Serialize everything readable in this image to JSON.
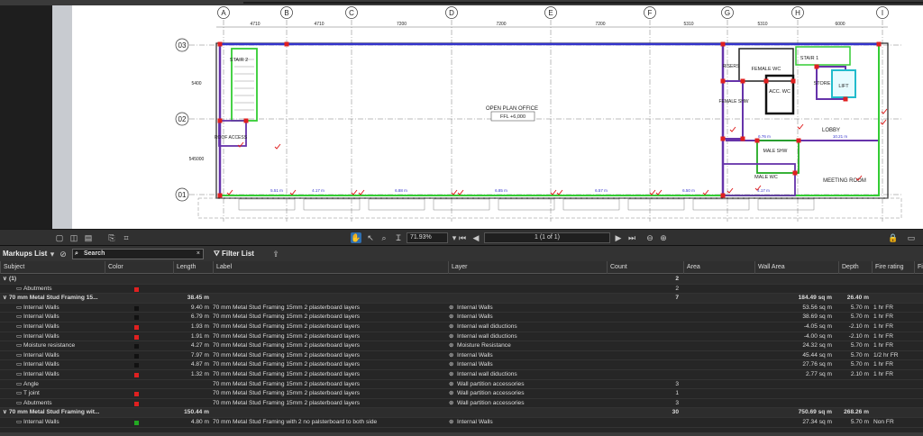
{
  "toolbar": {
    "zoom": "71.93%",
    "page": "1 (1 of 1)"
  },
  "panel": {
    "title": "Markups List",
    "search_placeholder": "Search",
    "filter_label": "Filter List"
  },
  "drawing": {
    "grid_cols": [
      "A",
      "B",
      "C",
      "D",
      "E",
      "F",
      "G",
      "H",
      "I"
    ],
    "col_dims": [
      "4710",
      "4710",
      "7200",
      "7200",
      "7200",
      "5310",
      "5310",
      "6000"
    ],
    "grid_rows": [
      "03",
      "02",
      "01"
    ],
    "row_dims": [
      "5400",
      "545000"
    ],
    "rooms": {
      "stair2": "STAIR 2",
      "office": "OPEN PLAN OFFICE",
      "ffl": "FFL +6,000",
      "risers": "RISERS",
      "female_wc": "FEMALE WC",
      "stair1": "STAIR 1",
      "acc_wc": "ACC. WC",
      "store": "STORE",
      "lift": "LIFT",
      "female_shw": "FEMALE SHW",
      "lobby": "LOBBY",
      "male_shw": "MALE SHW",
      "male_wc": "MALE WC",
      "meeting": "MEETING ROOM",
      "access": "ROOF ACCESS"
    },
    "measures": [
      "5.51 m",
      "4.17 m",
      "6.88 m",
      "6.85 m",
      "6.57 m",
      "6.50 m",
      "4.17 m",
      "6.76 m",
      "10.21 m"
    ]
  },
  "columns": [
    "Subject",
    "Color",
    "Length",
    "Label",
    "Layer",
    "Count",
    "Area",
    "Wall Area",
    "Depth",
    "Fire rating",
    "Fi"
  ],
  "rows": [
    {
      "type": "grp",
      "subject": "(1)",
      "color": "",
      "length": "",
      "label": "",
      "layer": "",
      "count": "2",
      "area": "",
      "wall_area": "",
      "depth": "",
      "fire": ""
    },
    {
      "type": "item",
      "subject": "Abutments",
      "color": "#e02020",
      "length": "",
      "label": "",
      "layer": "",
      "count": "2",
      "area": "",
      "wall_area": "",
      "depth": "",
      "fire": ""
    },
    {
      "type": "grp",
      "subject": "70 mm Metal Stud Framing 15...",
      "color": "",
      "length": "38.45 m",
      "label": "",
      "layer": "",
      "count": "7",
      "area": "",
      "wall_area": "184.49 sq m",
      "depth": "26.40 m",
      "fire": ""
    },
    {
      "type": "item",
      "subject": "Internal Walls",
      "color": "#111111",
      "length": "9.40 m",
      "label": "70 mm Metal Stud Framing 15mm 2 plasterboard layers",
      "layer": "Internal Walls",
      "count": "",
      "area": "",
      "wall_area": "53.56 sq m",
      "depth": "5.70 m",
      "fire": "1 hr FR"
    },
    {
      "type": "item",
      "subject": "Internal Walls",
      "color": "#111111",
      "length": "6.79 m",
      "label": "70 mm Metal Stud Framing 15mm 2 plasterboard layers",
      "layer": "Internal Walls",
      "count": "",
      "area": "",
      "wall_area": "38.69 sq m",
      "depth": "5.70 m",
      "fire": "1 hr FR"
    },
    {
      "type": "item",
      "subject": "Internal Walls",
      "color": "#e02020",
      "length": "1.93 m",
      "label": "70 mm Metal Stud Framing 15mm 2 plasterboard layers",
      "layer": "Internal wall diductions",
      "count": "",
      "area": "",
      "wall_area": "-4.05 sq m",
      "depth": "-2.10 m",
      "fire": "1 hr FR"
    },
    {
      "type": "item",
      "subject": "Internal Walls",
      "color": "#e02020",
      "length": "1.91 m",
      "label": "70 mm Metal Stud Framing 15mm 2 plasterboard layers",
      "layer": "Internal wall diductions",
      "count": "",
      "area": "",
      "wall_area": "-4.00 sq m",
      "depth": "-2.10 m",
      "fire": "1 hr FR"
    },
    {
      "type": "item",
      "subject": "Moisture resistance",
      "color": "#111111",
      "length": "4.27 m",
      "label": "70 mm Metal Stud Framing 15mm 2 plasterboard layers",
      "layer": "Moisture Resistance",
      "count": "",
      "area": "",
      "wall_area": "24.32 sq m",
      "depth": "5.70 m",
      "fire": "1 hr FR"
    },
    {
      "type": "item",
      "subject": "Internal Walls",
      "color": "#111111",
      "length": "7.97 m",
      "label": "70 mm Metal Stud Framing 15mm 2 plasterboard layers",
      "layer": "Internal Walls",
      "count": "",
      "area": "",
      "wall_area": "45.44 sq m",
      "depth": "5.70 m",
      "fire": "1/2 hr FR"
    },
    {
      "type": "item",
      "subject": "Internal Walls",
      "color": "#111111",
      "length": "4.87 m",
      "label": "70 mm Metal Stud Framing 15mm 2 plasterboard layers",
      "layer": "Internal Walls",
      "count": "",
      "area": "",
      "wall_area": "27.76 sq m",
      "depth": "5.70 m",
      "fire": "1 hr FR"
    },
    {
      "type": "item",
      "subject": "Internal Walls",
      "color": "#e02020",
      "length": "1.32 m",
      "label": "70 mm Metal Stud Framing 15mm 2 plasterboard layers",
      "layer": "Internal wall diductions",
      "count": "",
      "area": "",
      "wall_area": "2.77 sq m",
      "depth": "2.10 m",
      "fire": "1 hr FR"
    },
    {
      "type": "item",
      "subject": "Angle",
      "color": "",
      "length": "",
      "label": "70 mm Metal Stud Framing 15mm 2 plasterboard layers",
      "layer": "Wall partition accessories",
      "count": "3",
      "area": "",
      "wall_area": "",
      "depth": "",
      "fire": ""
    },
    {
      "type": "item",
      "subject": "T joint",
      "color": "#e02020",
      "length": "",
      "label": "70 mm Metal Stud Framing 15mm 2 plasterboard layers",
      "layer": "Wall partition accessories",
      "count": "1",
      "area": "",
      "wall_area": "",
      "depth": "",
      "fire": ""
    },
    {
      "type": "item",
      "subject": "Abutments",
      "color": "#e02020",
      "length": "",
      "label": "70 mm Metal Stud Framing 15mm 2 plasterboard layers",
      "layer": "Wall partition accessories",
      "count": "3",
      "area": "",
      "wall_area": "",
      "depth": "",
      "fire": ""
    },
    {
      "type": "grp",
      "subject": "70 mm Metal Stud Framing wit...",
      "color": "",
      "length": "150.44 m",
      "label": "",
      "layer": "",
      "count": "30",
      "area": "",
      "wall_area": "750.69 sq m",
      "depth": "268.26 m",
      "fire": ""
    },
    {
      "type": "item",
      "subject": "Internal Walls",
      "color": "#22aa22",
      "length": "4.80 m",
      "label": "70 mm Metal Stud Framing with 2 no palsterboard to both side",
      "layer": "Internal Walls",
      "count": "",
      "area": "",
      "wall_area": "27.34 sq m",
      "depth": "5.70 m",
      "fire": "Non FR"
    }
  ]
}
